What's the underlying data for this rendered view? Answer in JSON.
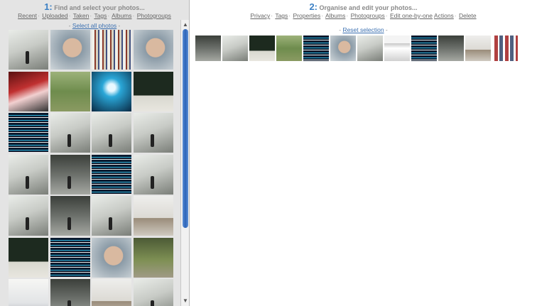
{
  "left": {
    "step_number": "1:",
    "heading": "Find and select your photos...",
    "nav": [
      "Recent",
      "Uploaded",
      "Taken",
      "Tags",
      "Albums",
      "Photogroups"
    ],
    "select_all_prefix": "- ",
    "select_all": "Select all photos",
    "select_all_suffix": " -"
  },
  "right": {
    "step_number": "2:",
    "heading": "Organise and edit your photos...",
    "nav": [
      "Privacy",
      "Tags",
      "Properties",
      "Albums",
      "Photogroups",
      "Edit one-by-one",
      "Actions",
      "Delete"
    ],
    "reset_prefix": "- ",
    "reset": "Reset selection",
    "reset_suffix": " -"
  },
  "scrollbar": {
    "up_glyph": "▲",
    "down_glyph": "▼"
  },
  "thumbnails": [
    "room",
    "face",
    "shelf",
    "face",
    "red",
    "grass",
    "blue",
    "book",
    "screen",
    "room",
    "room",
    "room",
    "room",
    "dark",
    "screen",
    "room",
    "room",
    "dark",
    "room",
    "table",
    "book",
    "screen",
    "face",
    "garden",
    "laptop",
    "dark",
    "table",
    "room"
  ],
  "selected_strip": [
    "dark",
    "room",
    "book",
    "grass",
    "screen",
    "face",
    "room",
    "web",
    "screen",
    "dark",
    "table",
    "photos"
  ]
}
